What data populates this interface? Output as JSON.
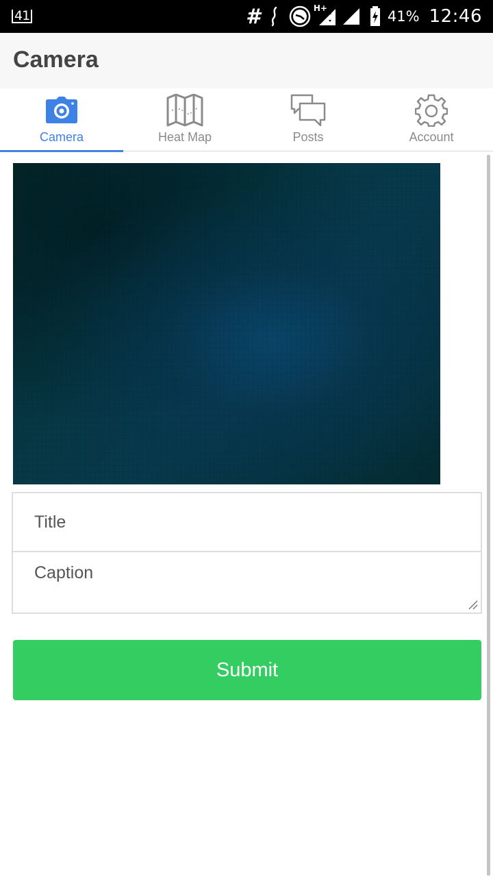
{
  "status_bar": {
    "notification_count": "41",
    "hash_symbol": "#",
    "network_type": "H+",
    "battery_percent": "41%",
    "time": "12:46",
    "icons": [
      "notification-badge-icon",
      "hashtag-icon",
      "vibrate-icon",
      "data-saver-icon",
      "signal-hplus-icon",
      "signal-icon",
      "battery-charging-icon"
    ]
  },
  "app_bar": {
    "title": "Camera"
  },
  "tabs": [
    {
      "label": "Camera",
      "icon": "camera-icon",
      "active": true
    },
    {
      "label": "Heat Map",
      "icon": "map-icon",
      "active": false
    },
    {
      "label": "Posts",
      "icon": "chat-bubbles-icon",
      "active": false
    },
    {
      "label": "Account",
      "icon": "gear-icon",
      "active": false
    }
  ],
  "form": {
    "title_placeholder": "Title",
    "title_value": "",
    "caption_placeholder": "Caption",
    "caption_value": "",
    "submit_label": "Submit"
  },
  "colors": {
    "accent": "#3e82e6",
    "submit": "#34cd61",
    "tab_inactive": "#8a8a8a",
    "app_bar_bg": "#f7f7f7"
  }
}
